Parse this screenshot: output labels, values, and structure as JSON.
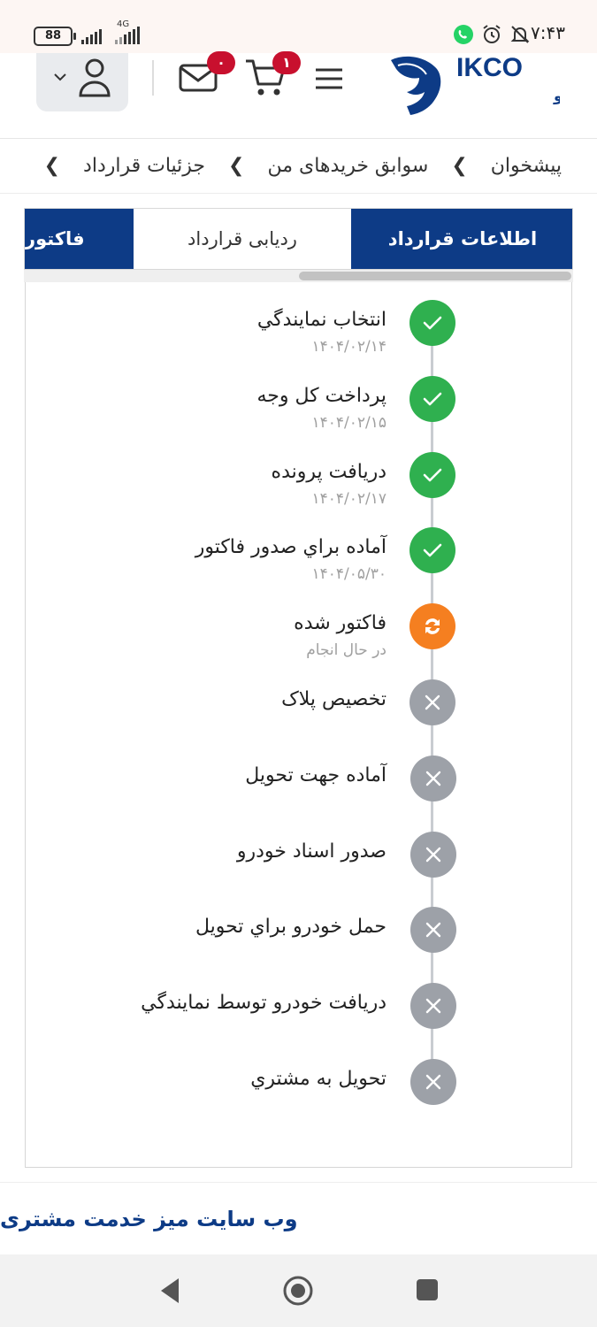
{
  "status_bar": {
    "time": "۷:۴۳",
    "battery": "88",
    "network": "4G"
  },
  "header": {
    "cart_badge": "۱",
    "mail_badge": "۰",
    "logo_text": "IKCO",
    "logo_subtext": "ایران خودرو"
  },
  "breadcrumb": {
    "items": [
      "پیشخوان",
      "سوابق خریدهای من",
      "جزئیات قرارداد"
    ]
  },
  "tabs": [
    {
      "label": "اطلاعات قرارداد",
      "state": "active"
    },
    {
      "label": "ردیابی قرارداد",
      "state": "inactive"
    },
    {
      "label": "فاکتور",
      "state": "active"
    }
  ],
  "timeline": [
    {
      "title": "انتخاب نمايندگي",
      "sub": "۱۴۰۴/۰۲/۱۴",
      "status": "done"
    },
    {
      "title": "پرداخت کل وجه",
      "sub": "۱۴۰۴/۰۲/۱۵",
      "status": "done"
    },
    {
      "title": "دريافت پرونده",
      "sub": "۱۴۰۴/۰۲/۱۷",
      "status": "done"
    },
    {
      "title": "آماده براي صدور فاکتور",
      "sub": "۱۴۰۴/۰۵/۳۰",
      "status": "done"
    },
    {
      "title": "فاکتور شده",
      "sub": "در حال انجام",
      "status": "in-progress"
    },
    {
      "title": "تخصيص پلاک",
      "sub": "",
      "status": "pending"
    },
    {
      "title": "آماده جهت تحويل",
      "sub": "",
      "status": "pending"
    },
    {
      "title": "صدور اسناد خودرو",
      "sub": "",
      "status": "pending"
    },
    {
      "title": "حمل خودرو براي تحويل",
      "sub": "",
      "status": "pending"
    },
    {
      "title": "دريافت خودرو توسط نمايندگي",
      "sub": "",
      "status": "pending"
    },
    {
      "title": "تحويل به مشتري",
      "sub": "",
      "status": "pending"
    }
  ],
  "footer": {
    "link_label": "وب سایت میز خدمت مشتری"
  },
  "colors": {
    "primary": "#0d3b86",
    "done": "#2fb04f",
    "in_progress": "#f57f20",
    "pending": "#9da1a8",
    "badge": "#c8102e"
  }
}
